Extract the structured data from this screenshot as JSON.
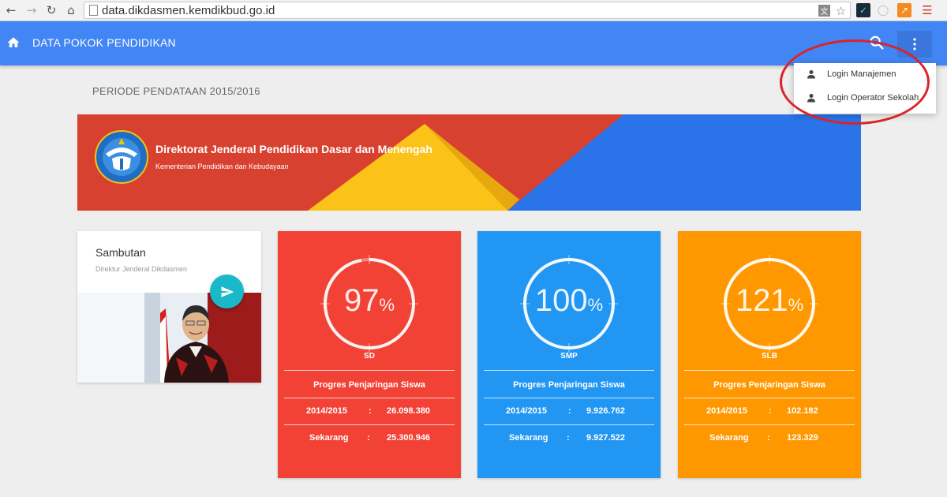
{
  "browser": {
    "url": "data.dikdasmen.kemdikbud.go.id"
  },
  "appbar": {
    "title": "DATA POKOK PENDIDIKAN"
  },
  "periode": "PERIODE PENDATAAN 2015/2016",
  "menu": {
    "items": [
      {
        "label": "Login Manajemen",
        "icon": "person-icon"
      },
      {
        "label": "Login Operator Sekolah",
        "icon": "person-icon"
      }
    ]
  },
  "banner": {
    "title": "Direktorat Jenderal Pendidikan Dasar dan Menengah",
    "subtitle": "Kementerian Pendidikan dan Kebudayaan",
    "logo_text": "TUT WURI HANDAYANI",
    "colors": {
      "red": "#d84130",
      "yellow": "#fbc318",
      "blue": "#2b73e8"
    }
  },
  "sambutan": {
    "title": "Sambutan",
    "subtitle": "Direktur Jenderal Dikdasmen"
  },
  "cards": [
    {
      "level": "SD",
      "percent": "97",
      "unit": "%",
      "fraction": 0.97,
      "color": "#f24236",
      "progress_label": "Progres Penjaringan Siswa",
      "rows": [
        {
          "label": "2014/2015",
          "sep": ":",
          "value": "26.098.380"
        },
        {
          "label": "Sekarang",
          "sep": ":",
          "value": "25.300.946"
        }
      ]
    },
    {
      "level": "SMP",
      "percent": "100",
      "unit": "%",
      "fraction": 1.0,
      "color": "#2196f3",
      "progress_label": "Progres Penjaringan Siswa",
      "rows": [
        {
          "label": "2014/2015",
          "sep": ":",
          "value": "9.926.762"
        },
        {
          "label": "Sekarang",
          "sep": ":",
          "value": "9.927.522"
        }
      ]
    },
    {
      "level": "SLB",
      "percent": "121",
      "unit": "%",
      "fraction": 1.0,
      "color": "#ff9800",
      "progress_label": "Progres Penjaringan Siswa",
      "rows": [
        {
          "label": "2014/2015",
          "sep": ":",
          "value": "102.182"
        },
        {
          "label": "Sekarang",
          "sep": ":",
          "value": "123.329"
        }
      ]
    }
  ]
}
